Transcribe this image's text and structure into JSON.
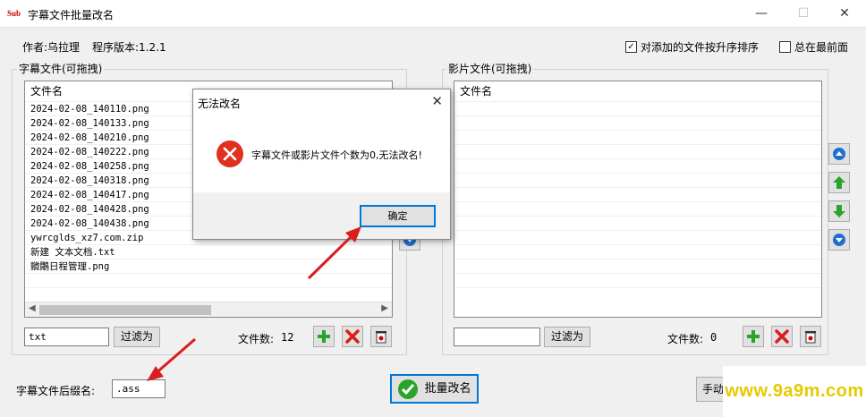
{
  "window": {
    "title": "字幕文件批量改名",
    "app_icon_text": "Sub",
    "minimize": "—",
    "maximize": "☐",
    "close": "✕"
  },
  "header": {
    "author": "作者:乌拉理",
    "version": "程序版本:1.2.1",
    "sort_checkbox": {
      "label": "对添加的文件按升序排序",
      "checked": true
    },
    "ontop_checkbox": {
      "label": "总在最前面",
      "checked": false
    }
  },
  "subtitle_panel": {
    "group_label": "字幕文件(可拖拽)",
    "column_header": "文件名",
    "files": [
      "2024-02-08_140110.png",
      "2024-02-08_140133.png",
      "2024-02-08_140210.png",
      "2024-02-08_140222.png",
      "2024-02-08_140258.png",
      "2024-02-08_140318.png",
      "2024-02-08_140417.png",
      "2024-02-08_140428.png",
      "2024-02-08_140438.png",
      "ywrcglds_xz7.com.zip",
      "新建 文本文档.txt",
      "覹鷳日程管理.png"
    ],
    "filter_value": "txt",
    "filter_button": "过滤为",
    "count_label": "文件数:",
    "count": "12"
  },
  "video_panel": {
    "group_label": "影片文件(可拖拽)",
    "column_header": "文件名",
    "files": [],
    "filter_value": "",
    "filter_button": "过滤为",
    "count_label": "文件数:",
    "count": "0"
  },
  "footer": {
    "suffix_label": "字幕文件后缀名:",
    "suffix_value": ".ass",
    "batch_rename_button": "批量改名",
    "manual_button": "手动"
  },
  "dialog": {
    "title": "无法改名",
    "message": "字幕文件或影片文件个数为0,无法改名!",
    "ok_button": "确定"
  },
  "watermark": "www.9a9m.com",
  "colors": {
    "accent": "#0078d7",
    "error_red": "#e0301e",
    "arrow_red": "#d81e1e",
    "plus_green": "#2aa32a",
    "watermark_yellow": "#e8c900"
  }
}
